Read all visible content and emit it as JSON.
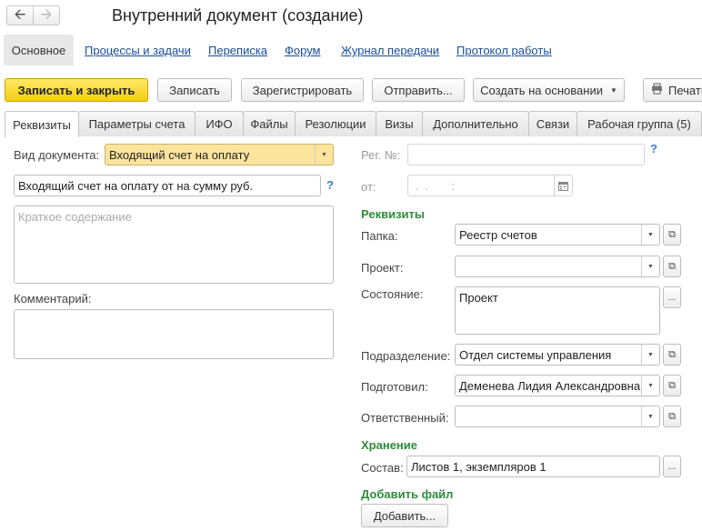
{
  "window": {
    "title": "Внутренний документ (создание)"
  },
  "sections": {
    "main": "Основное",
    "links": [
      "Процессы и задачи",
      "Переписка",
      "Форум",
      "Журнал передачи",
      "Протокол работы"
    ]
  },
  "toolbar": {
    "save_close": "Записать и закрыть",
    "save": "Записать",
    "register": "Зарегистрировать",
    "send": "Отправить...",
    "create_based": "Создать на основании",
    "print": "Печать"
  },
  "tabs": [
    "Реквизиты",
    "Параметры счета",
    "ИФО",
    "Файлы",
    "Резолюции",
    "Визы",
    "Дополнительно",
    "Связи",
    "Рабочая группа (5)"
  ],
  "form": {
    "doc_type_label": "Вид документа:",
    "doc_type_value": "Входящий счет на оплату",
    "doc_title_value": "Входящий счет на оплату  от  на сумму  руб.",
    "summary_placeholder": "Краткое содержание",
    "comment_label": "Комментарий:",
    "reg_no_label": "Рег. №:",
    "from_label": "от:",
    "date_mask": " .  .       :",
    "help_mark": "?",
    "requisites_title": "Реквизиты",
    "folder_label": "Папка:",
    "folder_value": "Реестр счетов",
    "project_label": "Проект:",
    "project_value": "",
    "state_label": "Состояние:",
    "state_value": "Проект",
    "department_label": "Подразделение:",
    "department_value": "Отдел системы управления",
    "prepared_label": "Подготовил:",
    "prepared_value": "Деменева Лидия Александровна",
    "responsible_label": "Ответственный:",
    "responsible_value": "",
    "storage_title": "Хранение",
    "composition_label": "Состав:",
    "composition_value": "Листов 1, экземпляров 1",
    "add_file_title": "Добавить файл",
    "add_button": "Добавить..."
  }
}
